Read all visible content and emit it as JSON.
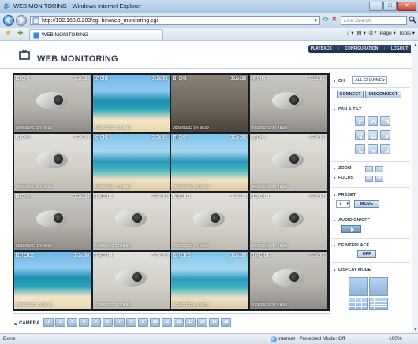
{
  "window": {
    "title": "WEB MONITORING - Windows Internet Explorer",
    "minimize": "–",
    "maximize": "□",
    "close": "✕"
  },
  "browser": {
    "url": "http://192.168.0.203/cgi-bin/web_monitoring.cgi",
    "search_placeholder": "Live Search",
    "tab_title": "WEB MONITORING",
    "tools": [
      "Page ▾",
      "Tools ▾"
    ]
  },
  "app": {
    "title": "WEB MONITORING",
    "menu": [
      "PLAYBACK",
      "CONFIGURATION",
      "LOGOUT"
    ]
  },
  "cameras": [
    {
      "label": "[1] CH1",
      "res": "352x288",
      "ts": "2008/09/02 14:48:39",
      "scene": "indoor"
    },
    {
      "label": "[2] CH2",
      "res": "352x288",
      "ts": "2008/09/02 14:48:39",
      "scene": "beach"
    },
    {
      "label": "[3] CH3",
      "res": "352x288",
      "ts": "2008/09/02 14:48:39",
      "scene": "store"
    },
    {
      "label": "[4] CH4",
      "res": "352x288",
      "ts": "2008/09/02 14:48:39",
      "scene": "indoor"
    },
    {
      "label": "[5] CH5",
      "res": "352x288",
      "ts": "2008/09/02 14:48:39",
      "scene": "bright"
    },
    {
      "label": "[6] CH6",
      "res": "352x288",
      "ts": "2008/09/02 14:48:39",
      "scene": "beach2"
    },
    {
      "label": "[7] CH7",
      "res": "352x288",
      "ts": "2008/09/02 14:48:39",
      "scene": "beach2"
    },
    {
      "label": "[8] CH8",
      "res": "352x288",
      "ts": "2008/09/02 14:48:39",
      "scene": "bright"
    },
    {
      "label": "[9] CH9",
      "res": "352x288",
      "ts": "2008/09/02 14:48:39",
      "scene": "indoor"
    },
    {
      "label": "[10] CH10",
      "res": "352x288",
      "ts": "2008/09/02 14:48:39",
      "scene": "bright"
    },
    {
      "label": "[11] CH11",
      "res": "352x288",
      "ts": "2008/09/02 14:48:39",
      "scene": "bright"
    },
    {
      "label": "[12] CH12",
      "res": "352x288",
      "ts": "2008/09/02 14:48:39",
      "scene": "bright"
    },
    {
      "label": "[13] CH13",
      "res": "352x288",
      "ts": "2008/09/02 14:48:39",
      "scene": "beach"
    },
    {
      "label": "[14] CH14",
      "res": "352x288",
      "ts": "2008/09/02 14:48:39",
      "scene": "bright"
    },
    {
      "label": "[15] CH15",
      "res": "352x288",
      "ts": "2008/09/02 14:48:42",
      "scene": "beach2"
    },
    {
      "label": "[16] CH16",
      "res": "352x288",
      "ts": "2008/09/02 14:48:39",
      "scene": "indoor"
    }
  ],
  "camera_bar": {
    "label": "CAMERA",
    "buttons": [
      "1",
      "2",
      "3",
      "4",
      "5",
      "6",
      "7",
      "8",
      "9",
      "10",
      "11",
      "12",
      "13",
      "14",
      "15",
      "16"
    ]
  },
  "panel": {
    "ch_label": "CH",
    "ch_value": "ALL CHANNEL",
    "connect": "CONNECT",
    "disconnect": "DISCONNECT",
    "pan_tilt": "PAN & TILT",
    "zoom": "ZOOM",
    "focus": "FOCUS",
    "zoom_minus": "-",
    "zoom_plus": "+",
    "focus_minus": "-",
    "focus_plus": "+",
    "preset": "PRESET",
    "preset_value": "1",
    "move": "MOVE",
    "audio": "AUDIO ON/OFF",
    "deinterlace": "DEINTERLACE",
    "deinterlace_state": "OFF",
    "display_mode": "DISPLAY MODE"
  },
  "status": {
    "left": "Done",
    "zone": "Internet | Protected Mode: Off",
    "zoom": "100%"
  },
  "colors": {
    "accent": "#1b2f4e",
    "button": "#a8c3e0"
  }
}
